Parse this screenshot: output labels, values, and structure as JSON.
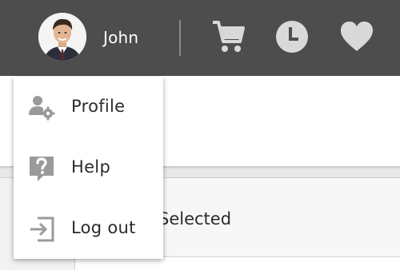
{
  "header": {
    "user_name": "John",
    "icons": [
      "avatar",
      "cart-icon",
      "clock-icon",
      "heart-icon"
    ],
    "background_color": "#4d4d4d",
    "icon_color": "#d9d9d9"
  },
  "user_menu": {
    "items": [
      {
        "label": "Profile",
        "icon": "user-gear-icon"
      },
      {
        "label": "Help",
        "icon": "help-question-icon"
      },
      {
        "label": "Log out",
        "icon": "logout-icon"
      }
    ],
    "icon_color": "#9a9a9a"
  },
  "content": {
    "panel_label": "Selected"
  }
}
